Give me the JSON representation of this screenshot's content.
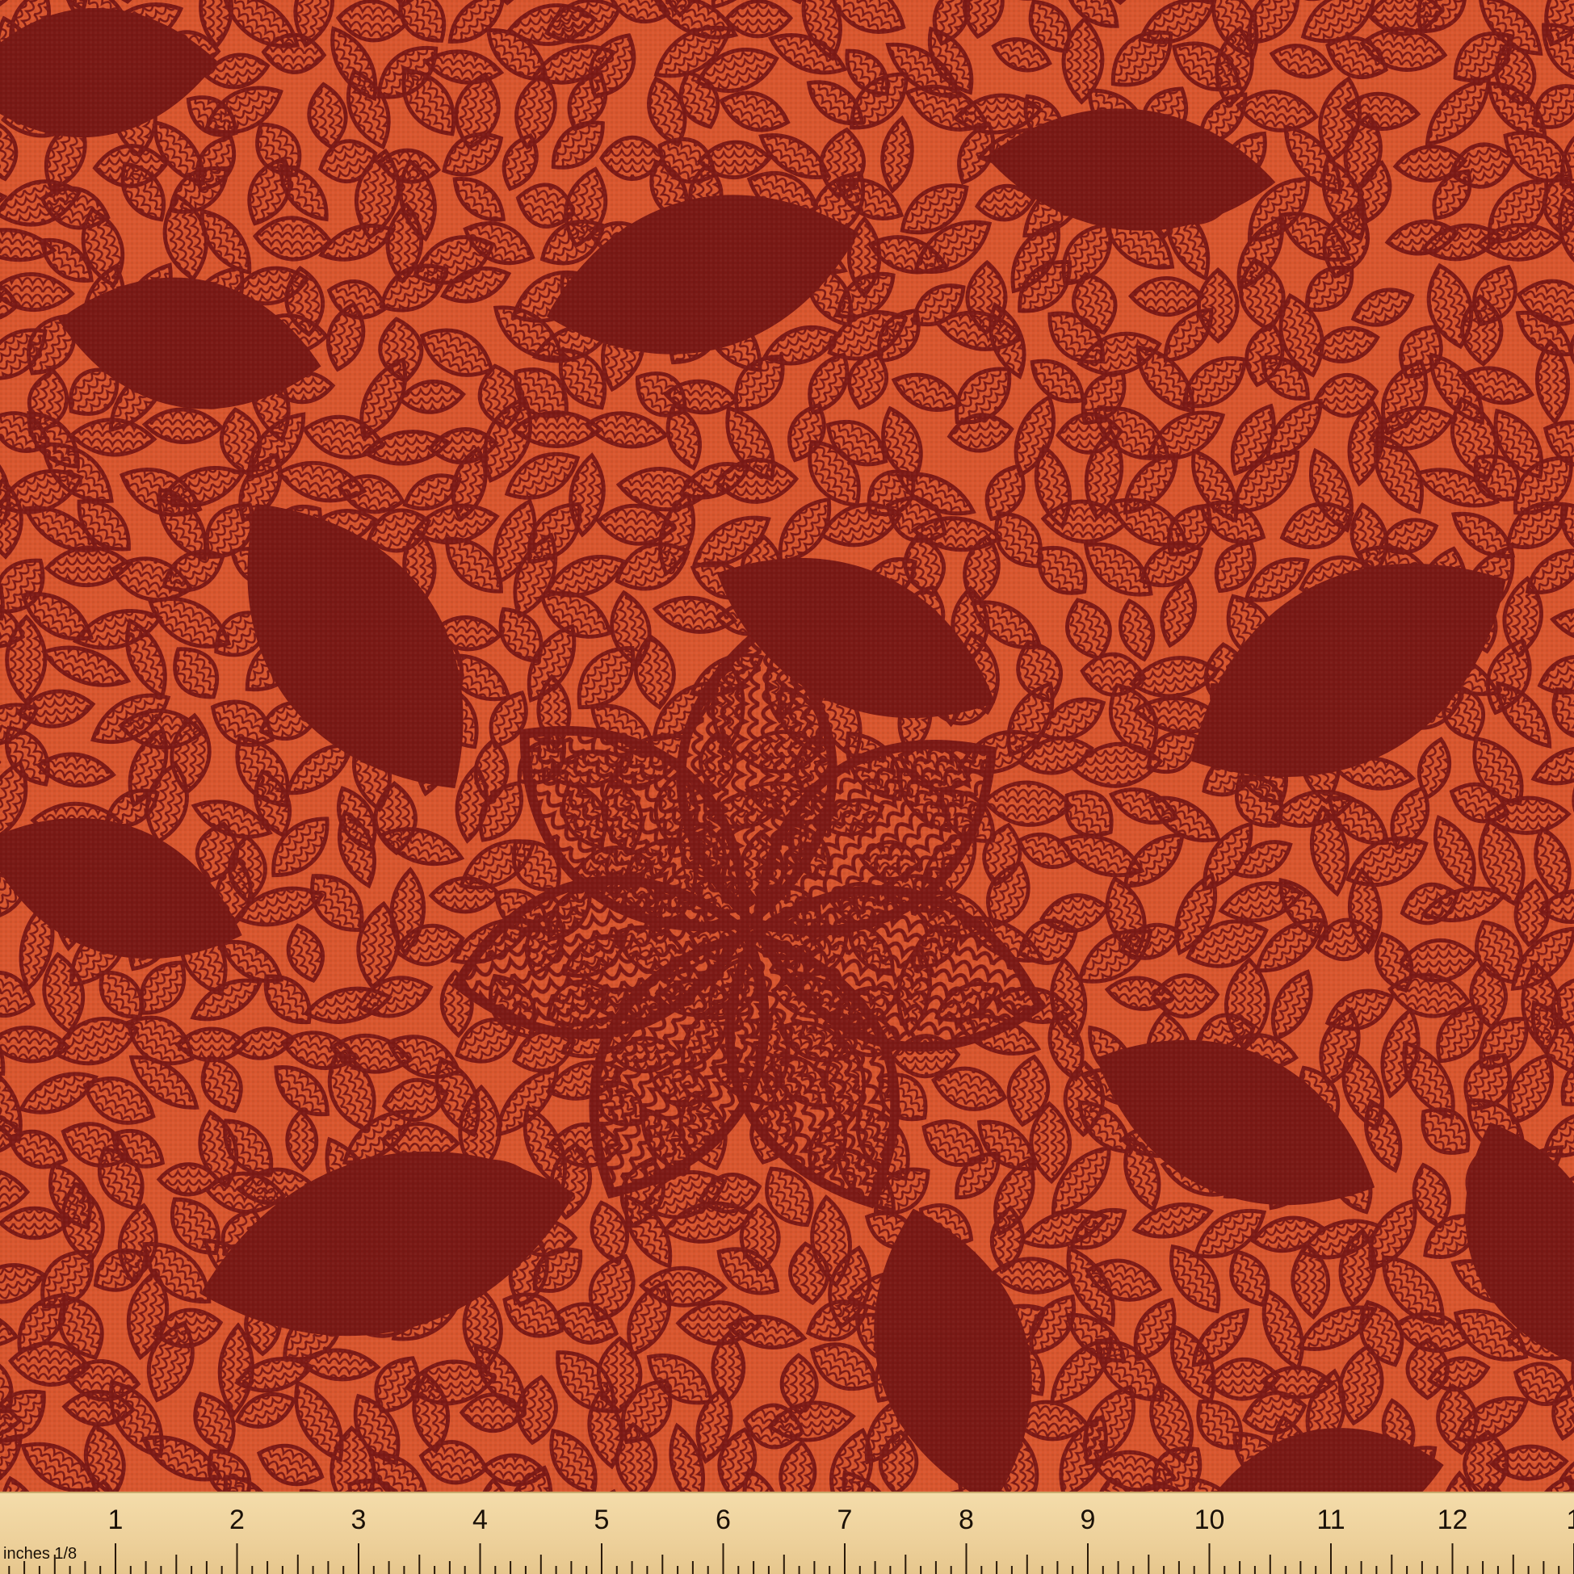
{
  "colors": {
    "background": "#d9562e",
    "outline": "#7d1a16",
    "solid_leaf": "#7a1915",
    "ruler": "#efd39e"
  },
  "ruler": {
    "unit_label": "inches",
    "fraction_label": "1/8",
    "numbers": [
      "1",
      "2",
      "3",
      "4",
      "5",
      "6",
      "7",
      "8",
      "9",
      "10",
      "11",
      "12",
      "1"
    ]
  }
}
